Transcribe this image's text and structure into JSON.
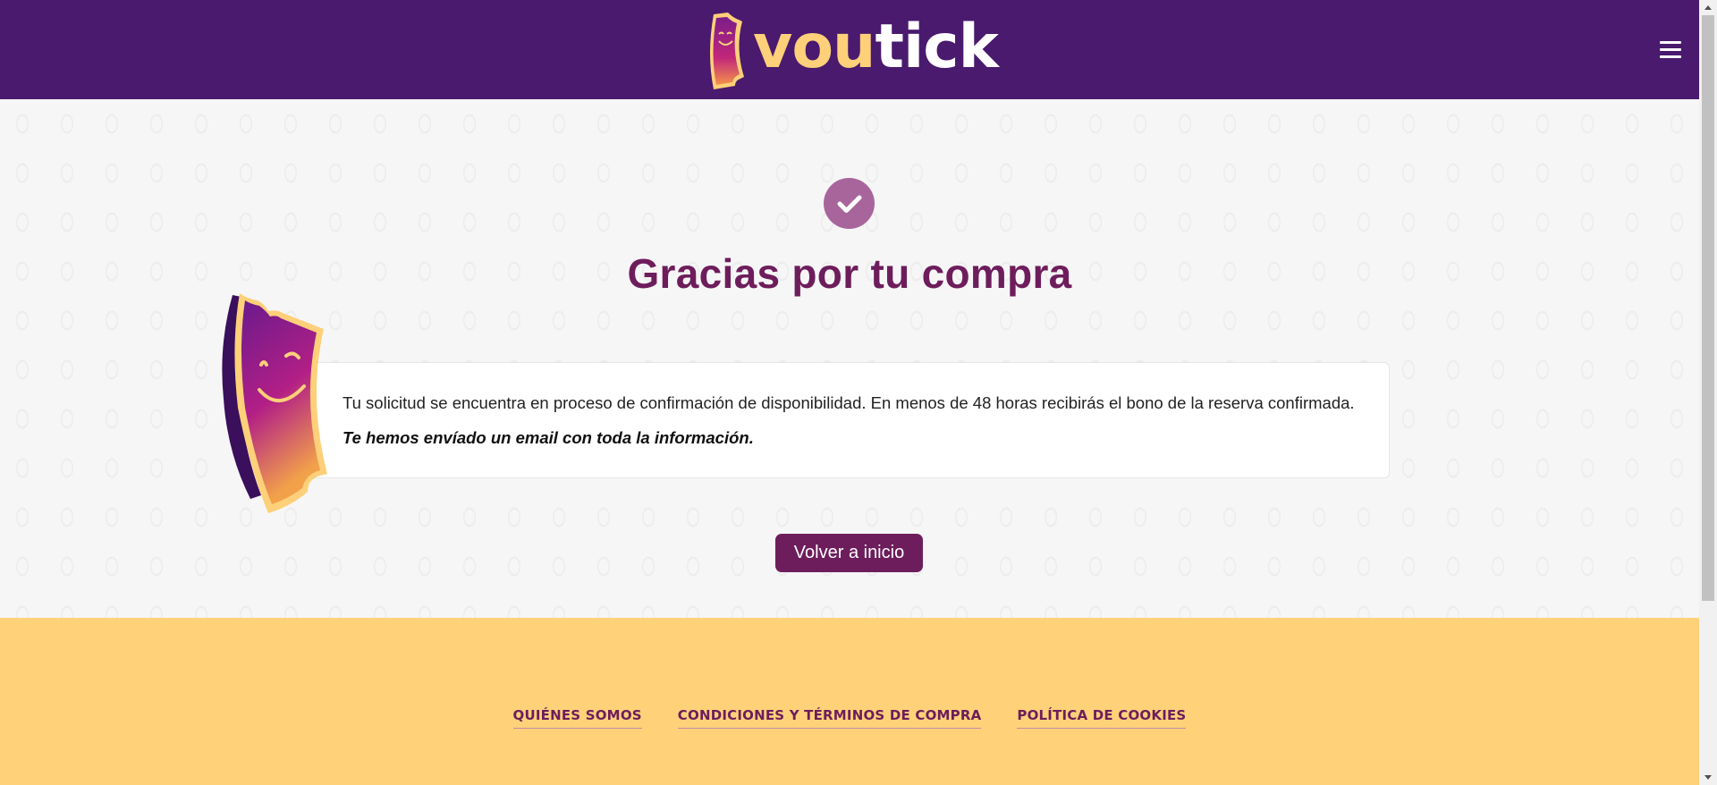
{
  "header": {
    "logo_text_part1": "vou",
    "logo_text_part2": "tick",
    "menu_icon": "hamburger-menu-icon"
  },
  "main": {
    "status_icon": "check-circle-icon",
    "title": "Gracias por tu compra",
    "message": "Tu solicitud se encuentra en proceso de confirmación de disponibilidad. En menos de 48 horas recibirás el bono de la reserva confirmada.",
    "email_notice": "Te hemos envíado un email con toda la información.",
    "home_button": "Volver a inicio"
  },
  "footer": {
    "links": [
      "QUIÉNES SOMOS",
      "CONDICIONES Y TÉRMINOS DE COMPRA",
      "POLÍTICA DE COOKIES"
    ]
  },
  "colors": {
    "header_bg": "#4a1a6e",
    "brand_primary": "#6e1d5c",
    "brand_yellow": "#ffd27a",
    "check_bg": "#a8659c"
  }
}
